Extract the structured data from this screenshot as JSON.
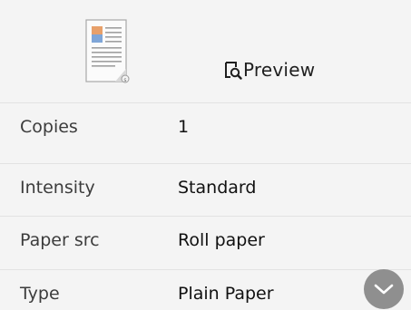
{
  "preview": {
    "label": "Preview",
    "icon": "preview-magnifier-icon"
  },
  "document": {
    "icon": "document-thumbnail-icon"
  },
  "settings": [
    {
      "label": "Copies",
      "value": "1"
    },
    {
      "label": "Intensity",
      "value": "Standard"
    },
    {
      "label": "Paper src",
      "value": "Roll paper"
    },
    {
      "label": "Type",
      "value": "Plain Paper"
    }
  ],
  "scroll": {
    "icon": "chevron-down-icon"
  },
  "colors": {
    "background": "#f4f4f4",
    "divider": "#e2e2e2",
    "scroll_button": "#8f8f8f"
  }
}
